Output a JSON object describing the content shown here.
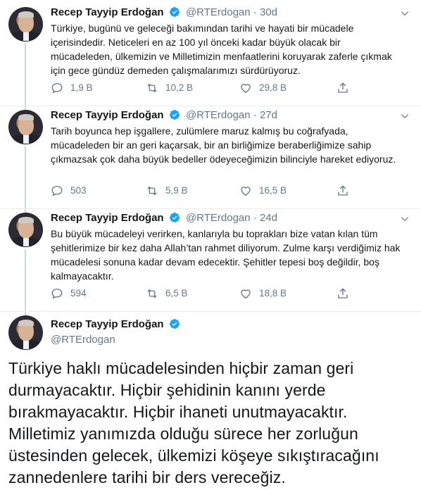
{
  "author": {
    "name": "Recep Tayyip Erdoğan",
    "handle": "@RTErdogan",
    "dot": "·"
  },
  "colors": {
    "verified": "#1da1f2",
    "icon": "#657786",
    "divider": "#e6ecf0"
  },
  "tweets": [
    {
      "time": "30d",
      "text": "Türkiye, bugünü ve geleceği bakımından tarihi ve hayati bir mücadele içerisindedir. Neticeleri en az 100 yıl önceki kadar büyük olacak bir mücadeleden, ülkemizin ve Milletimizin menfaatlerini koruyarak zaferle çıkmak için gece gündüz demeden çalışmalarımızı sürdürüyoruz.",
      "replies": "1,9 B",
      "retweets": "10,2 B",
      "likes": "29,8 B"
    },
    {
      "time": "27d",
      "text": "Tarih boyunca hep işgallere, zulümlere maruz kalmış bu coğrafyada, mücadeleden bir an geri kaçarsak, bir an birliğimize beraberliğimize sahip çıkmazsak çok daha büyük bedeller ödeyeceğimizin bilinciyle hareket ediyoruz.",
      "replies": "503",
      "retweets": "5,9 B",
      "likes": "16,5 B"
    },
    {
      "time": "24d",
      "text": "Bu büyük mücadeleyi verirken, kanlarıyla bu toprakları bize vatan kılan tüm şehitlerimize bir kez daha Allah’tan rahmet diliyorum. Zulme karşı verdiğimiz hak mücadelesi sonuna kadar devam edecektir. Şehitler tepesi boş değildir, boş kalmayacaktır.",
      "replies": "594",
      "retweets": "6,5 B",
      "likes": "18,8 B"
    }
  ],
  "main_tweet": {
    "text": "Türkiye haklı mücadelesinden hiçbir zaman geri durmayacaktır. Hiçbir şehidinin kanını yerde bırakmayacaktır. Hiçbir ihaneti unutmayacaktır. Milletimiz yanımızda olduğu sürece her zorluğun üstesinden gelecek, ülkemizi köşeye sıkıştıracağını zannedenlere tarihi bir ders vereceğiz."
  },
  "icons": [
    "reply-icon",
    "retweet-icon",
    "like-icon",
    "share-icon",
    "verified-badge-icon",
    "chevron-down-icon"
  ]
}
